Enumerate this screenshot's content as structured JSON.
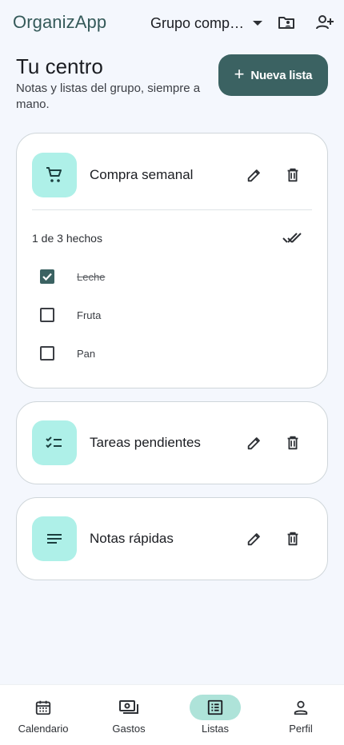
{
  "app": {
    "brand": "OrganizApp"
  },
  "header": {
    "group_label": "Grupo compartido",
    "title": "Tu centro",
    "subtitle": "Notas y listas del grupo, siempre a mano.",
    "new_list_label": "Nueva lista"
  },
  "icons": {
    "group_dropdown": "chevron-down-icon",
    "folder": "folder-shared-icon",
    "add_member": "person-add-icon",
    "edit": "pencil-icon",
    "delete": "trash-icon",
    "done_all": "done-all-icon"
  },
  "colors": {
    "accent": "#3b6262",
    "tile": "#aef0e8",
    "nav_active": "#aee3d9",
    "background": "#f4f7fd"
  },
  "lists": [
    {
      "title": "Compra semanal",
      "icon": "shopping-cart-icon",
      "expanded": true,
      "progress": "1 de 3 hechos",
      "items": [
        {
          "label": "Leche",
          "checked": true
        },
        {
          "label": "Fruta",
          "checked": false
        },
        {
          "label": "Pan",
          "checked": false
        }
      ]
    },
    {
      "title": "Tareas pendientes",
      "icon": "checklist-icon",
      "expanded": false
    },
    {
      "title": "Notas rápidas",
      "icon": "notes-icon",
      "expanded": false
    }
  ],
  "nav": [
    {
      "label": "Calendario",
      "icon": "calendar-icon",
      "active": false
    },
    {
      "label": "Gastos",
      "icon": "payments-icon",
      "active": false
    },
    {
      "label": "Listas",
      "icon": "list-alt-icon",
      "active": true
    },
    {
      "label": "Perfil",
      "icon": "person-icon",
      "active": false
    }
  ]
}
